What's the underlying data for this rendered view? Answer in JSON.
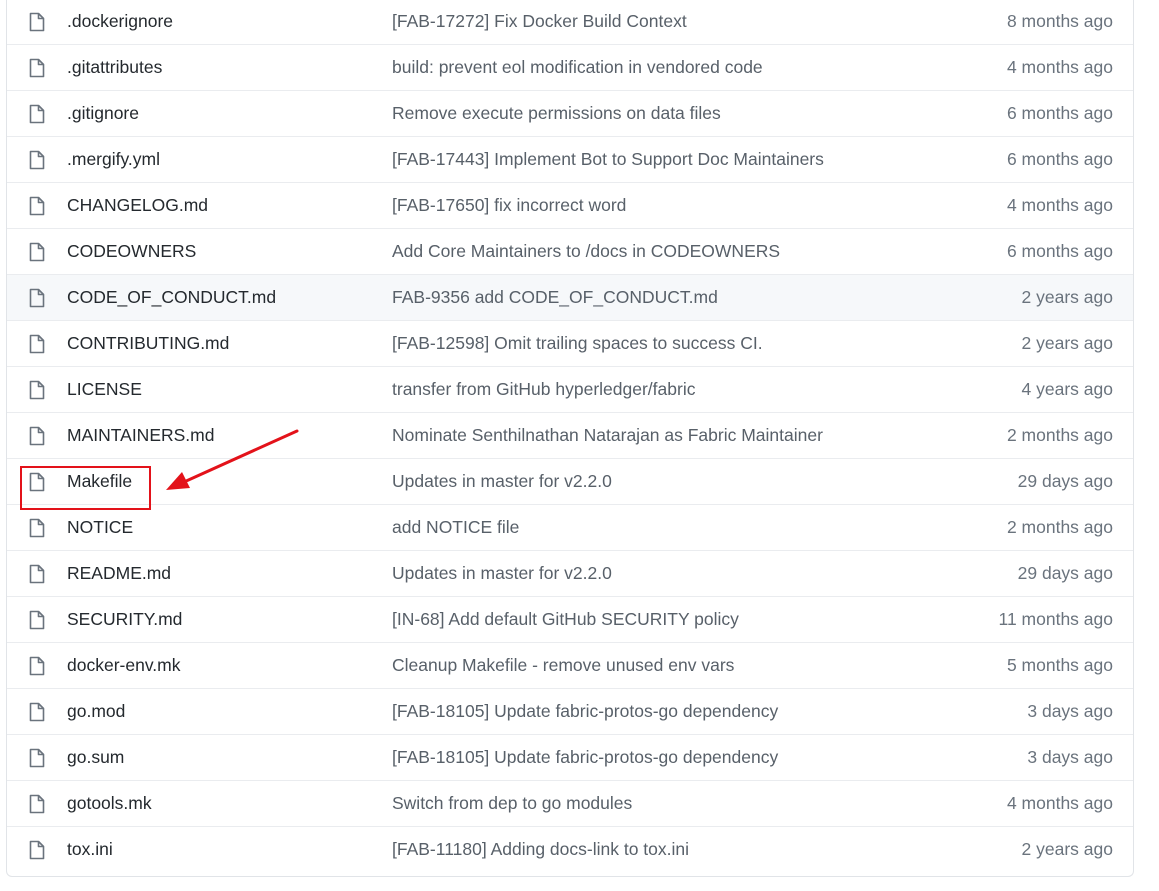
{
  "files": [
    {
      "name": ".dockerignore",
      "message": "[FAB-17272] Fix Docker Build Context",
      "age": "8 months ago"
    },
    {
      "name": ".gitattributes",
      "message": "build: prevent eol modification in vendored code",
      "age": "4 months ago"
    },
    {
      "name": ".gitignore",
      "message": "Remove execute permissions on data files",
      "age": "6 months ago"
    },
    {
      "name": ".mergify.yml",
      "message": "[FAB-17443] Implement Bot to Support Doc Maintainers",
      "age": "6 months ago"
    },
    {
      "name": "CHANGELOG.md",
      "message": "[FAB-17650] fix incorrect word",
      "age": "4 months ago"
    },
    {
      "name": "CODEOWNERS",
      "message": "Add Core Maintainers to /docs in CODEOWNERS",
      "age": "6 months ago"
    },
    {
      "name": "CODE_OF_CONDUCT.md",
      "message": "FAB-9356 add CODE_OF_CONDUCT.md",
      "age": "2 years ago"
    },
    {
      "name": "CONTRIBUTING.md",
      "message": "[FAB-12598] Omit trailing spaces to success CI.",
      "age": "2 years ago"
    },
    {
      "name": "LICENSE",
      "message": "transfer from GitHub hyperledger/fabric",
      "age": "4 years ago"
    },
    {
      "name": "MAINTAINERS.md",
      "message": "Nominate Senthilnathan Natarajan as Fabric Maintainer",
      "age": "2 months ago"
    },
    {
      "name": "Makefile",
      "message": "Updates in master for v2.2.0",
      "age": "29 days ago"
    },
    {
      "name": "NOTICE",
      "message": "add NOTICE file",
      "age": "2 months ago"
    },
    {
      "name": "README.md",
      "message": "Updates in master for v2.2.0",
      "age": "29 days ago"
    },
    {
      "name": "SECURITY.md",
      "message": "[IN-68] Add default GitHub SECURITY policy",
      "age": "11 months ago"
    },
    {
      "name": "docker-env.mk",
      "message": "Cleanup Makefile - remove unused env vars",
      "age": "5 months ago"
    },
    {
      "name": "go.mod",
      "message": "[FAB-18105] Update fabric-protos-go dependency",
      "age": "3 days ago"
    },
    {
      "name": "go.sum",
      "message": "[FAB-18105] Update fabric-protos-go dependency",
      "age": "3 days ago"
    },
    {
      "name": "gotools.mk",
      "message": "Switch from dep to go modules",
      "age": "4 months ago"
    },
    {
      "name": "tox.ini",
      "message": "[FAB-11180] Adding docs-link to tox.ini",
      "age": "2 years ago"
    }
  ],
  "icon": "file-icon",
  "colors": {
    "annotation": "#e3121a",
    "hover_row": "#f6f8fa",
    "message_text": "#586069"
  }
}
